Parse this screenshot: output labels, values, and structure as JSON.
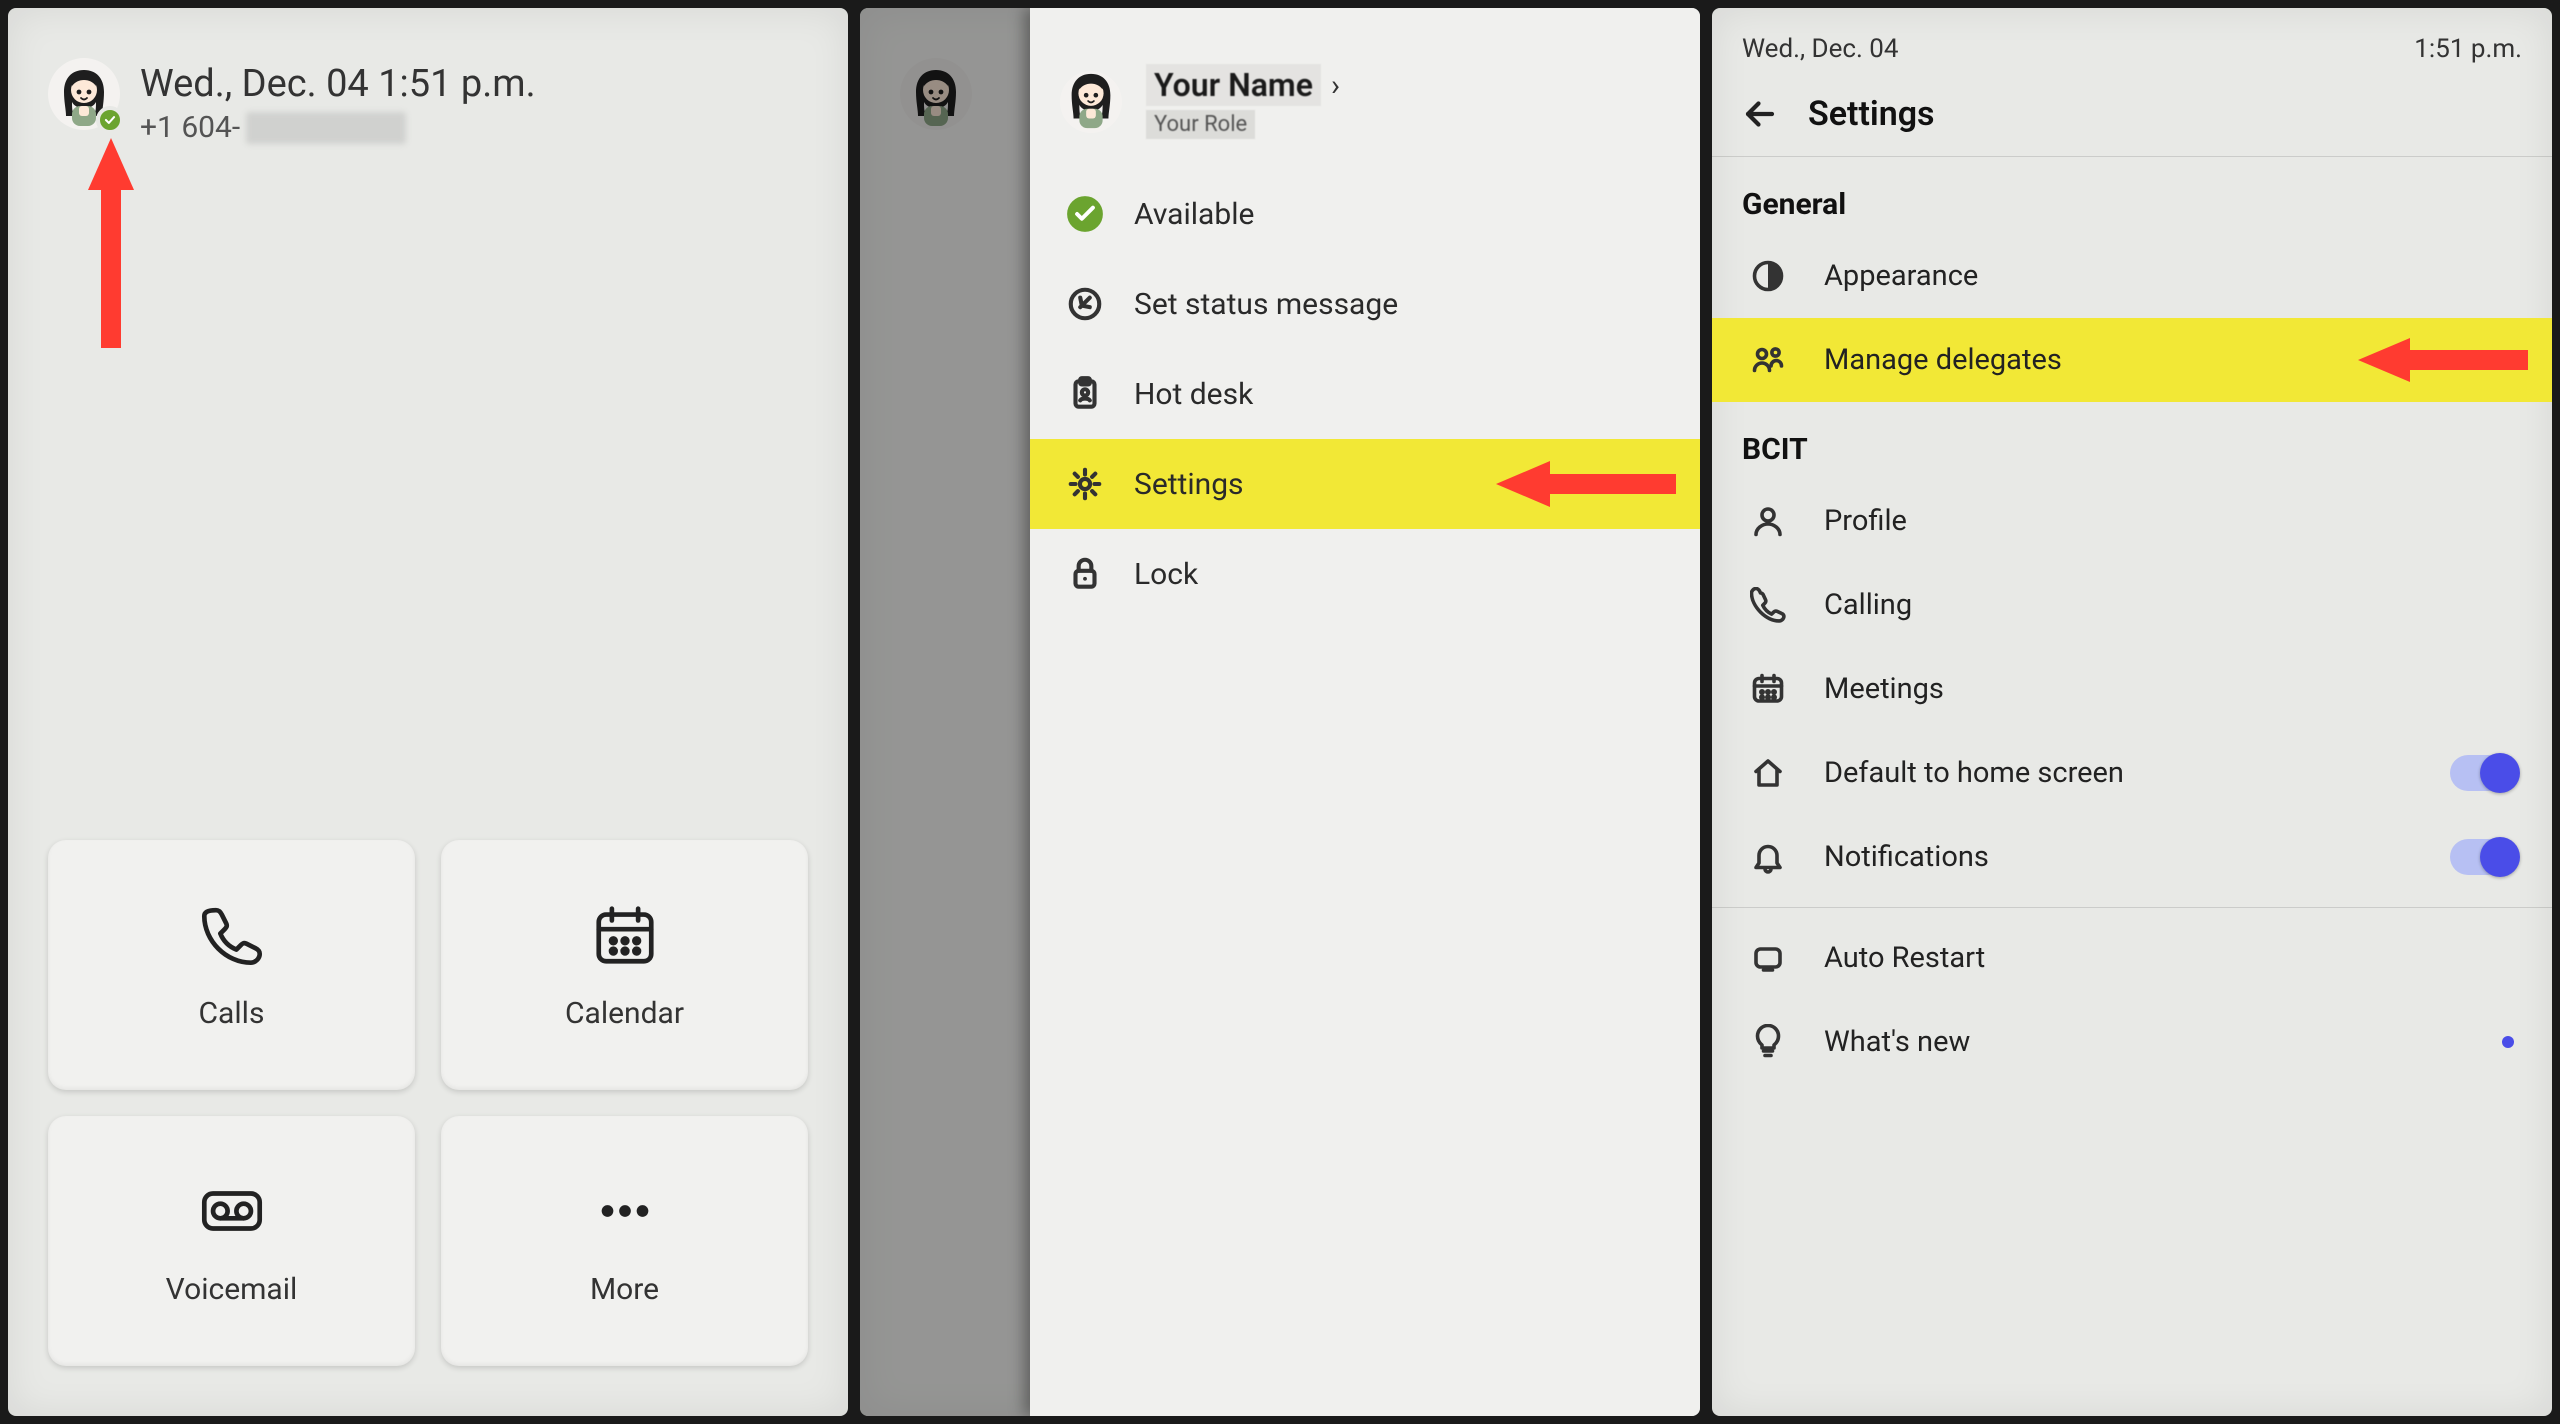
{
  "colors": {
    "highlight": "#f2e836",
    "presence_available": "#6ba42f",
    "toggle_accent": "#4a4de8",
    "annotation_arrow": "#ff3b30"
  },
  "screen1": {
    "datetime": "Wed., Dec. 04 1:51 p.m.",
    "phone_prefix": "+1 604-",
    "tiles": {
      "calls": {
        "label": "Calls",
        "icon": "phone-icon"
      },
      "calendar": {
        "label": "Calendar",
        "icon": "calendar-icon"
      },
      "voicemail": {
        "label": "Voicemail",
        "icon": "voicemail-icon"
      },
      "more": {
        "label": "More",
        "icon": "more-icon"
      }
    }
  },
  "screen2": {
    "profile": {
      "name": "Your Name",
      "role": "Your Role"
    },
    "menu": [
      {
        "id": "available",
        "label": "Available",
        "icon": "presence-available-icon",
        "highlighted": false
      },
      {
        "id": "status-msg",
        "label": "Set status message",
        "icon": "edit-icon",
        "highlighted": false
      },
      {
        "id": "hot-desk",
        "label": "Hot desk",
        "icon": "clipboard-icon",
        "highlighted": false
      },
      {
        "id": "settings",
        "label": "Settings",
        "icon": "gear-icon",
        "highlighted": true
      },
      {
        "id": "lock",
        "label": "Lock",
        "icon": "lock-icon",
        "highlighted": false
      }
    ]
  },
  "screen3": {
    "status_bar": {
      "left": "Wed., Dec. 04",
      "right": "1:51 p.m."
    },
    "title": "Settings",
    "sections": {
      "general": {
        "heading": "General",
        "items": {
          "appearance": {
            "label": "Appearance",
            "icon": "appearance-icon"
          },
          "manage_delegates": {
            "label": "Manage delegates",
            "icon": "delegates-icon",
            "highlighted": true
          }
        }
      },
      "bcit": {
        "heading": "BCIT",
        "items": {
          "profile": {
            "label": "Profile",
            "icon": "profile-icon"
          },
          "calling": {
            "label": "Calling",
            "icon": "phone-outline-icon"
          },
          "meetings": {
            "label": "Meetings",
            "icon": "meetings-icon"
          },
          "default_home": {
            "label": "Default to home screen",
            "icon": "home-icon",
            "toggle": true
          },
          "notifications": {
            "label": "Notifications",
            "icon": "bell-icon",
            "toggle": true
          },
          "auto_restart": {
            "label": "Auto Restart",
            "icon": "device-icon"
          },
          "whats_new": {
            "label": "What's new",
            "icon": "bulb-icon",
            "dot": true
          }
        }
      }
    }
  }
}
